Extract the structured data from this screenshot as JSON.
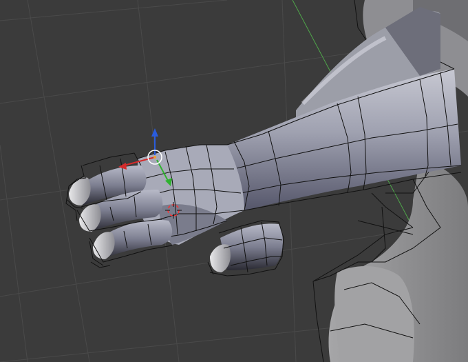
{
  "viewport": {
    "background": "#3b3b3b",
    "grid_color": "#4a4a4a",
    "axis_y_color": "#4fa64a",
    "mesh_fill": "#9a9cab",
    "mesh_shadow": "#2c2c33",
    "wire_color": "#111111",
    "body_fill": "#8a8a8c"
  },
  "gizmo": {
    "x_axis_color": "#d42b2b",
    "y_axis_color": "#2fb22f",
    "z_axis_color": "#2a5cdc",
    "pivot_ring": "#ffffff"
  },
  "cursor_3d": {
    "icon": "crosshair-3d-cursor-icon",
    "ring_colors": [
      "#ff3030",
      "#ffffff"
    ]
  }
}
